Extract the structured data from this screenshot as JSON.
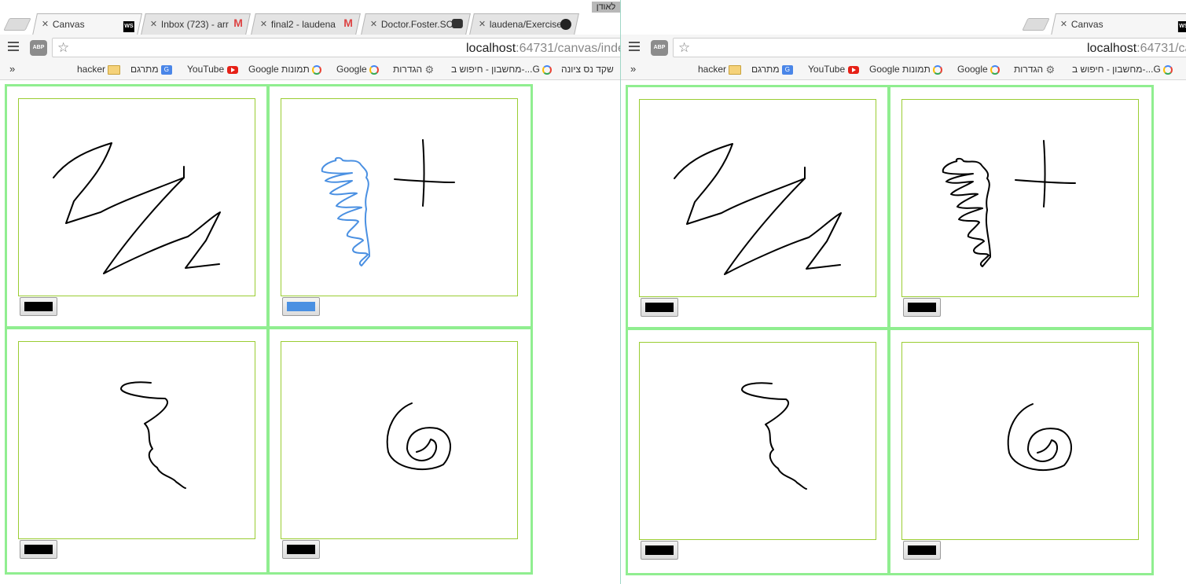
{
  "left_window": {
    "tabs": [
      {
        "label": "Canvas",
        "icon": "webstorm-icon"
      },
      {
        "label": "Inbox (723) - arr",
        "icon": "gmail-icon"
      },
      {
        "label": "final2 - laudena",
        "icon": "gmail-icon"
      },
      {
        "label": "Doctor.Foster.SC",
        "icon": "robot-icon"
      },
      {
        "label": "laudena/Exercise",
        "icon": "github-icon"
      }
    ],
    "profile_label": "לאודן",
    "url_host": "localhost",
    "url_path": ":64731/canvas/inde",
    "bookmarks": [
      "hacker",
      "מתרגם",
      "YouTube",
      "Google תמונות",
      "Google",
      "הגדרות",
      "מחשבון - חיפוש ב-...G",
      "שקד נס ציונה"
    ]
  },
  "right_window": {
    "tabs": [
      {
        "label": "Canvas",
        "icon": "webstorm-icon"
      }
    ],
    "url_host": "localhost",
    "url_path": ":64731/ca",
    "bookmarks": [
      "hacker",
      "מתרגם",
      "YouTube",
      "Google תמונות",
      "Google",
      "הגדרות",
      "מחשבון - חיפוש ב-...G"
    ]
  },
  "canvases": {
    "left": [
      "#000000",
      "#4a90e2",
      "#000000",
      "#000000"
    ],
    "right": [
      "#000000",
      "#000000",
      "#000000",
      "#000000"
    ]
  },
  "colors": {
    "cell_border": "#90ee90",
    "canvas_border": "#9acd32",
    "stroke_default": "#000000",
    "stroke_blue": "#4a90e2"
  }
}
